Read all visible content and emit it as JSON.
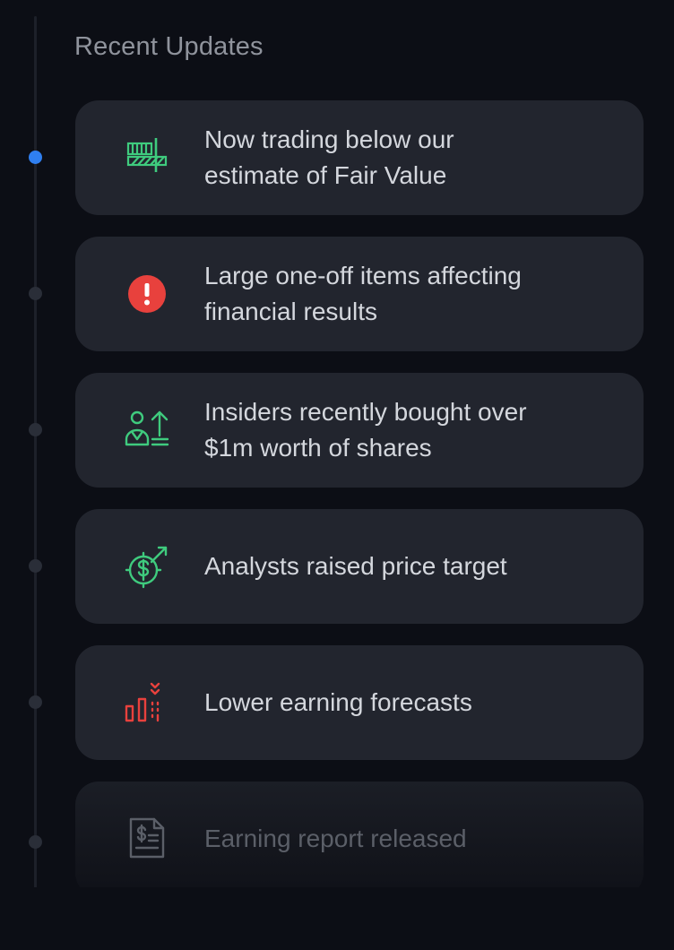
{
  "section": {
    "title": "Recent Updates"
  },
  "colors": {
    "background": "#0c0e15",
    "card": "#22252e",
    "active_dot": "#2f7ff0",
    "positive_icon": "#3fcb7e",
    "negative_icon": "#e8413d",
    "muted_icon": "#5b5f68"
  },
  "updates": [
    {
      "text": "Now trading below our\nestimate of Fair Value",
      "icon": "fair-value-icon",
      "active": true
    },
    {
      "text": "Large one-off items affecting\nfinancial results",
      "icon": "alert-icon",
      "active": false
    },
    {
      "text": "Insiders recently bought over\n$1m worth of shares",
      "icon": "insider-buy-icon",
      "active": false
    },
    {
      "text": "Analysts raised price target",
      "icon": "price-target-up-icon",
      "active": false
    },
    {
      "text": "Lower earning forecasts",
      "icon": "earnings-down-icon",
      "active": false
    },
    {
      "text": "Earning report released",
      "icon": "earnings-report-icon",
      "active": false
    }
  ]
}
